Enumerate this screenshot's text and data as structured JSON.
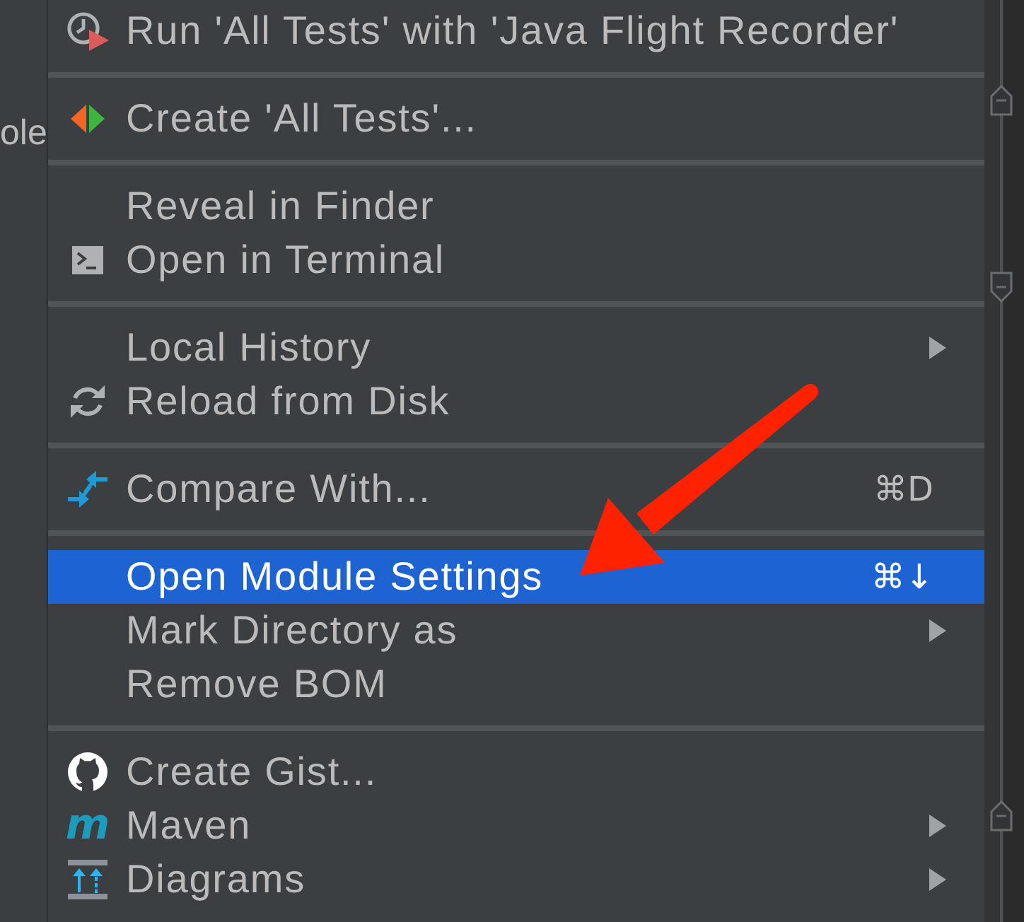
{
  "side_panel": {
    "text": "ole"
  },
  "menu": {
    "groups": [
      {
        "items": [
          {
            "label": "Run 'All Tests' with 'Java Flight Recorder'",
            "selected": false,
            "submenu": false
          }
        ]
      },
      {
        "items": [
          {
            "label": "Create 'All Tests'...",
            "selected": false,
            "submenu": false
          }
        ]
      },
      {
        "items": [
          {
            "label": "Reveal in Finder",
            "selected": false,
            "submenu": false
          },
          {
            "label": "Open in Terminal",
            "selected": false,
            "submenu": false
          }
        ]
      },
      {
        "items": [
          {
            "label": "Local History",
            "selected": false,
            "submenu": true
          },
          {
            "label": "Reload from Disk",
            "selected": false,
            "submenu": false
          }
        ]
      },
      {
        "items": [
          {
            "label": "Compare With...",
            "shortcut": "⌘D",
            "selected": false,
            "submenu": false
          }
        ]
      },
      {
        "items": [
          {
            "label": "Open Module Settings",
            "shortcut": "⌘↓",
            "selected": true,
            "submenu": false
          },
          {
            "label": "Mark Directory as",
            "selected": false,
            "submenu": true
          },
          {
            "label": "Remove BOM",
            "selected": false,
            "submenu": false
          }
        ]
      },
      {
        "items": [
          {
            "label": "Create Gist...",
            "selected": false,
            "submenu": false
          },
          {
            "label": "Maven",
            "icon_glyph": "m",
            "selected": false,
            "submenu": true
          },
          {
            "label": "Diagrams",
            "selected": false,
            "submenu": true
          }
        ]
      }
    ]
  }
}
